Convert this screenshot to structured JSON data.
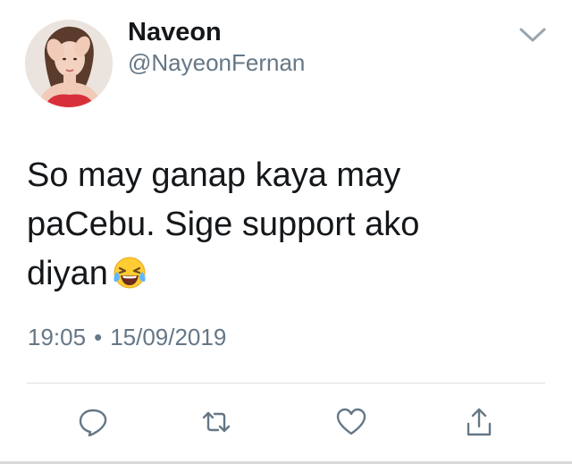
{
  "tweet": {
    "author": {
      "display_name": "Naveon",
      "handle": "@NayeonFernan",
      "avatar_icon": "profile-photo"
    },
    "text_lines": [
      "So may ganap kaya may",
      "paCebu. Sige support ako",
      "diyan"
    ],
    "emoji": "face-with-tears-of-joy",
    "time": "19:05",
    "separator": "•",
    "date": "15/09/2019"
  },
  "actions": [
    {
      "icon": "reply-icon"
    },
    {
      "icon": "retweet-icon"
    },
    {
      "icon": "like-icon"
    },
    {
      "icon": "share-icon"
    }
  ],
  "menu_icon": "chevron-down-icon",
  "colors": {
    "text": "#14171a",
    "secondary": "#657786",
    "divider": "#dbe1e6"
  }
}
